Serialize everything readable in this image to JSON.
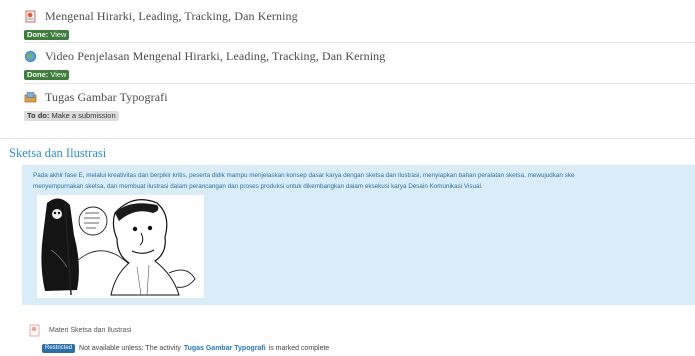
{
  "activities": [
    {
      "title": "Mengenal Hirarki, Leading, Tracking, Dan Kerning",
      "status_label": "Done:",
      "status_value": "View",
      "icon": "page-icon"
    },
    {
      "title": "Video Penjelasan Mengenal Hirarki, Leading, Tracking, Dan Kerning",
      "status_label": "Done:",
      "status_value": "View",
      "icon": "url-icon"
    },
    {
      "title": "Tugas Gambar Typografi",
      "status_label": "To do:",
      "status_value": "Make a submission",
      "icon": "assignment-icon"
    }
  ],
  "section": {
    "title": "Sketsa dan Ilustrasi",
    "summary_line1": "Pada akhir fase E, melalui kreativitas dan berpikir kritis, peserta didik mampu menjelaskan konsep dasar karya dengan sketsa dan ilustrasi, menyiapkan bahan peralatan sketsa, mewujudkan ske",
    "summary_line2": "menyempurnakan sketsa, dan membuat ilustrasi dalam perancangan dan proses produksi untuk dikembangkan dalam eksekusi karya Desain Komunikasi Visual.",
    "lower_item_title": "Materi Sketsa dan Ilustrasi",
    "restriction_badge": "Restricted",
    "restriction_prefix": "Not available unless: The activity",
    "restriction_link": "Tugas Gambar Typografi",
    "restriction_suffix": "is marked complete"
  },
  "colors": {
    "done_badge": "#3e7d3c",
    "section_title": "#2a8fc9",
    "summary_bg": "#d9ecf8"
  }
}
